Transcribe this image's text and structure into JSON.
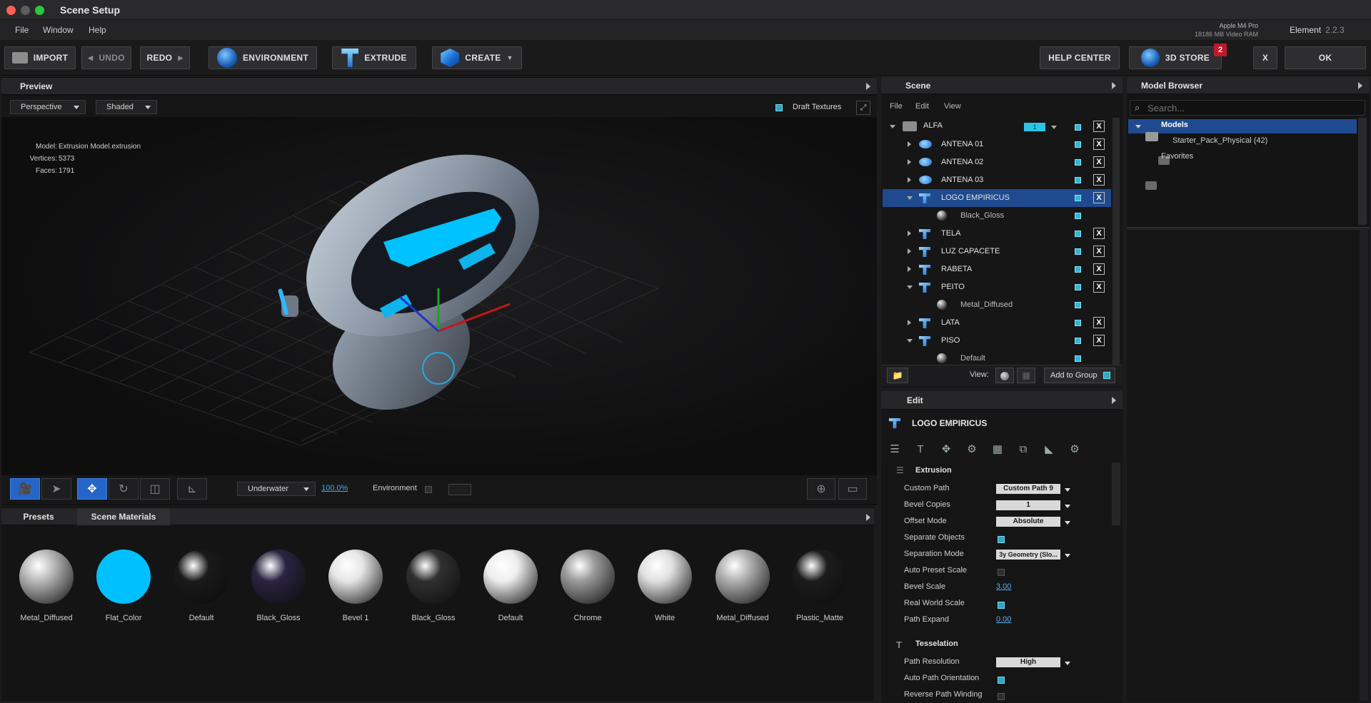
{
  "window": {
    "title": "Scene Setup"
  },
  "menu": {
    "items": [
      "File",
      "Window",
      "Help"
    ]
  },
  "gpu": {
    "name": "Apple M4 Pro",
    "vram": "18186 MB Video RAM"
  },
  "app": {
    "name": "Element",
    "version": "2.2.3"
  },
  "toolbar": {
    "import": "IMPORT",
    "undo": "UNDO",
    "redo": "REDO",
    "environment": "ENVIRONMENT",
    "extrude": "EXTRUDE",
    "create": "CREATE",
    "help_center": "HELP CENTER",
    "store": "3D STORE",
    "store_badge": "2",
    "close": "X",
    "ok": "OK"
  },
  "preview": {
    "title": "Preview",
    "camera": "Perspective",
    "shading": "Shaded",
    "draft_textures": "Draft Textures",
    "draft_textures_checked": true,
    "model_label": "Model:",
    "model_value": "Extrusion Model.extrusion",
    "vertices_label": "Vertices:",
    "vertices_value": "5373",
    "faces_label": "Faces:",
    "faces_value": "1791",
    "env_preset": "Underwater",
    "env_intensity": "100.0%",
    "environment_label": "Environment"
  },
  "materials": {
    "tabs": [
      "Presets",
      "Scene Materials"
    ],
    "active_tab": "Scene Materials",
    "items": [
      {
        "name": "Metal_Diffused",
        "color": "#b9b9b9"
      },
      {
        "name": "Flat_Color",
        "color": "#00c0ff"
      },
      {
        "name": "Default",
        "color": "#1a1a1a"
      },
      {
        "name": "Black_Gloss",
        "color": "#2a2440"
      },
      {
        "name": "Bevel 1",
        "color": "#e6e6e6"
      },
      {
        "name": "Black_Gloss",
        "color": "#303030"
      },
      {
        "name": "Default",
        "color": "#eeeeee"
      },
      {
        "name": "Chrome",
        "color": "#9a9a9a"
      },
      {
        "name": "White",
        "color": "#e0e0e0"
      },
      {
        "name": "Metal_Diffused",
        "color": "#b0b0b0"
      },
      {
        "name": "Plastic_Matte",
        "color": "#1c1c1c"
      }
    ]
  },
  "scene": {
    "title": "Scene",
    "menu": [
      "File",
      "Edit",
      "View"
    ],
    "group": {
      "name": "ALFA",
      "value": "1"
    },
    "rows": [
      {
        "name": "ANTENA 01",
        "type": "object",
        "expanded": false
      },
      {
        "name": "ANTENA 02",
        "type": "object",
        "expanded": false
      },
      {
        "name": "ANTENA 03",
        "type": "object",
        "expanded": false
      },
      {
        "name": "LOGO EMPIRICUS",
        "type": "object",
        "expanded": true,
        "selected": true
      },
      {
        "name": "Black_Gloss",
        "type": "material"
      },
      {
        "name": "TELA",
        "type": "object",
        "expanded": false
      },
      {
        "name": "LUZ CAPACETE",
        "type": "object",
        "expanded": false
      },
      {
        "name": "RABETA",
        "type": "object",
        "expanded": false
      },
      {
        "name": "PEITO",
        "type": "object",
        "expanded": true
      },
      {
        "name": "Metal_Diffused",
        "type": "material"
      },
      {
        "name": "LATA",
        "type": "object",
        "expanded": false
      },
      {
        "name": "PISO",
        "type": "object",
        "expanded": true
      },
      {
        "name": "Default",
        "type": "material"
      }
    ],
    "view_label": "View:",
    "add_to_group": "Add to Group"
  },
  "edit": {
    "title": "Edit",
    "object_name": "LOGO EMPIRICUS",
    "sections": {
      "extrusion": "Extrusion",
      "tesselation": "Tesselation"
    },
    "props": {
      "custom_path": {
        "label": "Custom Path",
        "value": "Custom Path 9"
      },
      "bevel_copies": {
        "label": "Bevel Copies",
        "value": "1"
      },
      "offset_mode": {
        "label": "Offset Mode",
        "value": "Absolute"
      },
      "separate_objects": {
        "label": "Separate Objects",
        "checked": true
      },
      "separation_mode": {
        "label": "Separation Mode",
        "value": "3y Geometry (Slo..."
      },
      "auto_preset_scale": {
        "label": "Auto Preset Scale",
        "checked": false
      },
      "bevel_scale": {
        "label": "Bevel Scale",
        "value": "3.00"
      },
      "real_world_scale": {
        "label": "Real World Scale",
        "checked": true
      },
      "path_expand": {
        "label": "Path Expand",
        "value": "0.00"
      },
      "path_resolution": {
        "label": "Path Resolution",
        "value": "High"
      },
      "auto_path_orientation": {
        "label": "Auto Path Orientation",
        "checked": true
      },
      "reverse_path_winding": {
        "label": "Reverse Path Winding",
        "checked": false
      }
    }
  },
  "model_browser": {
    "title": "Model Browser",
    "search_placeholder": "Search...",
    "tree": {
      "root": "Models",
      "child": "Starter_Pack_Physical (42)",
      "favorites": "Favorites"
    }
  }
}
